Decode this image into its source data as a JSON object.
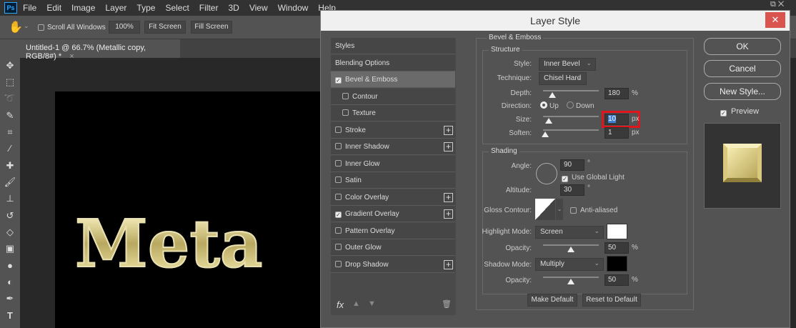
{
  "app": {
    "logo": "Ps",
    "menu": [
      "File",
      "Edit",
      "Image",
      "Layer",
      "Type",
      "Select",
      "Filter",
      "3D",
      "View",
      "Window",
      "Help"
    ]
  },
  "options": {
    "scroll_all": "Scroll All Windows",
    "zoom": "100%",
    "fit": "Fit Screen",
    "fill": "Fill Screen"
  },
  "document": {
    "tab": "Untitled-1 @ 66.7% (Metallic copy, RGB/8#) *",
    "canvas_text": "Meta"
  },
  "dialog": {
    "title": "Layer Style",
    "styles": [
      {
        "label": "Styles"
      },
      {
        "label": "Blending Options"
      },
      {
        "label": "Bevel & Emboss",
        "checked": true,
        "selected": true
      },
      {
        "label": "Contour",
        "checked": false,
        "sub": true
      },
      {
        "label": "Texture",
        "checked": false,
        "sub": true
      },
      {
        "label": "Stroke",
        "checked": false,
        "plus": true
      },
      {
        "label": "Inner Shadow",
        "checked": false,
        "plus": true
      },
      {
        "label": "Inner Glow",
        "checked": false
      },
      {
        "label": "Satin",
        "checked": false
      },
      {
        "label": "Color Overlay",
        "checked": false,
        "plus": true
      },
      {
        "label": "Gradient Overlay",
        "checked": true,
        "plus": true
      },
      {
        "label": "Pattern Overlay",
        "checked": false
      },
      {
        "label": "Outer Glow",
        "checked": false
      },
      {
        "label": "Drop Shadow",
        "checked": false,
        "plus": true
      }
    ],
    "fx": "fx",
    "bevel": {
      "title": "Bevel & Emboss",
      "structure": "Structure",
      "style_label": "Style:",
      "style": "Inner Bevel",
      "technique_label": "Technique:",
      "technique": "Chisel Hard",
      "depth_label": "Depth:",
      "depth": "180",
      "depth_unit": "%",
      "direction_label": "Direction:",
      "up": "Up",
      "down": "Down",
      "size_label": "Size:",
      "size": "10",
      "size_unit": "px",
      "soften_label": "Soften:",
      "soften": "1",
      "soften_unit": "px"
    },
    "shading": {
      "title": "Shading",
      "angle_label": "Angle:",
      "angle": "90",
      "deg": "°",
      "global_light": "Use Global Light",
      "altitude_label": "Altitude:",
      "altitude": "30",
      "gloss_label": "Gloss Contour:",
      "anti_aliased": "Anti-aliased",
      "highlight_label": "Highlight Mode:",
      "highlight": "Screen",
      "hl_opacity_label": "Opacity:",
      "hl_opacity": "50",
      "shadow_label": "Shadow Mode:",
      "shadow": "Multiply",
      "sh_opacity_label": "Opacity:",
      "sh_opacity": "50",
      "pct": "%"
    },
    "make_default": "Make Default",
    "reset_default": "Reset to Default",
    "ok": "OK",
    "cancel": "Cancel",
    "new_style": "New Style...",
    "preview": "Preview"
  }
}
